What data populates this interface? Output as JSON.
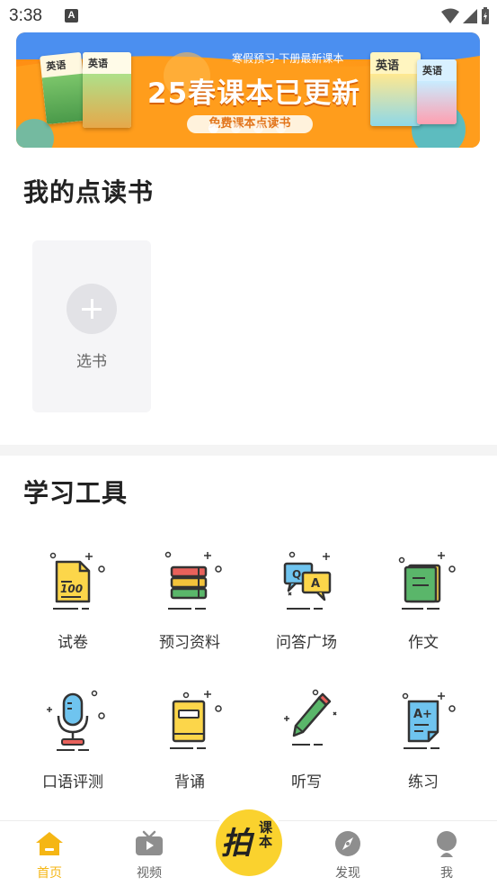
{
  "status_bar": {
    "time": "3:38",
    "notification_icon": "A"
  },
  "banner": {
    "tag": "寒假预习-下册最新课本",
    "title": "25春课本已更新",
    "pill": "免费课本点读书",
    "books": [
      "英语",
      "英语",
      "英语",
      "英语"
    ]
  },
  "my_books": {
    "title": "我的点读书",
    "add_label": "选书"
  },
  "tools": {
    "title": "学习工具",
    "items": [
      {
        "label": "试卷",
        "icon": "exam-paper-icon"
      },
      {
        "label": "预习资料",
        "icon": "book-stack-icon"
      },
      {
        "label": "问答广场",
        "icon": "qa-chat-icon"
      },
      {
        "label": "作文",
        "icon": "composition-notebook-icon"
      },
      {
        "label": "口语评测",
        "icon": "microphone-icon"
      },
      {
        "label": "背诵",
        "icon": "recite-book-icon"
      },
      {
        "label": "听写",
        "icon": "pencil-icon"
      },
      {
        "label": "练习",
        "icon": "practice-sheet-icon"
      }
    ]
  },
  "bottom_nav": {
    "items": [
      {
        "label": "首页",
        "icon": "home-icon",
        "active": true
      },
      {
        "label": "视频",
        "icon": "tv-icon",
        "active": false
      },
      {
        "label": "发现",
        "icon": "compass-icon",
        "active": false
      },
      {
        "label": "我",
        "icon": "profile-icon",
        "active": false
      }
    ],
    "center": {
      "main": "拍",
      "sub": "课本"
    }
  },
  "colors": {
    "accent": "#f5b614",
    "banner_orange": "#ff9c1a",
    "banner_blue": "#4b8ff0"
  }
}
